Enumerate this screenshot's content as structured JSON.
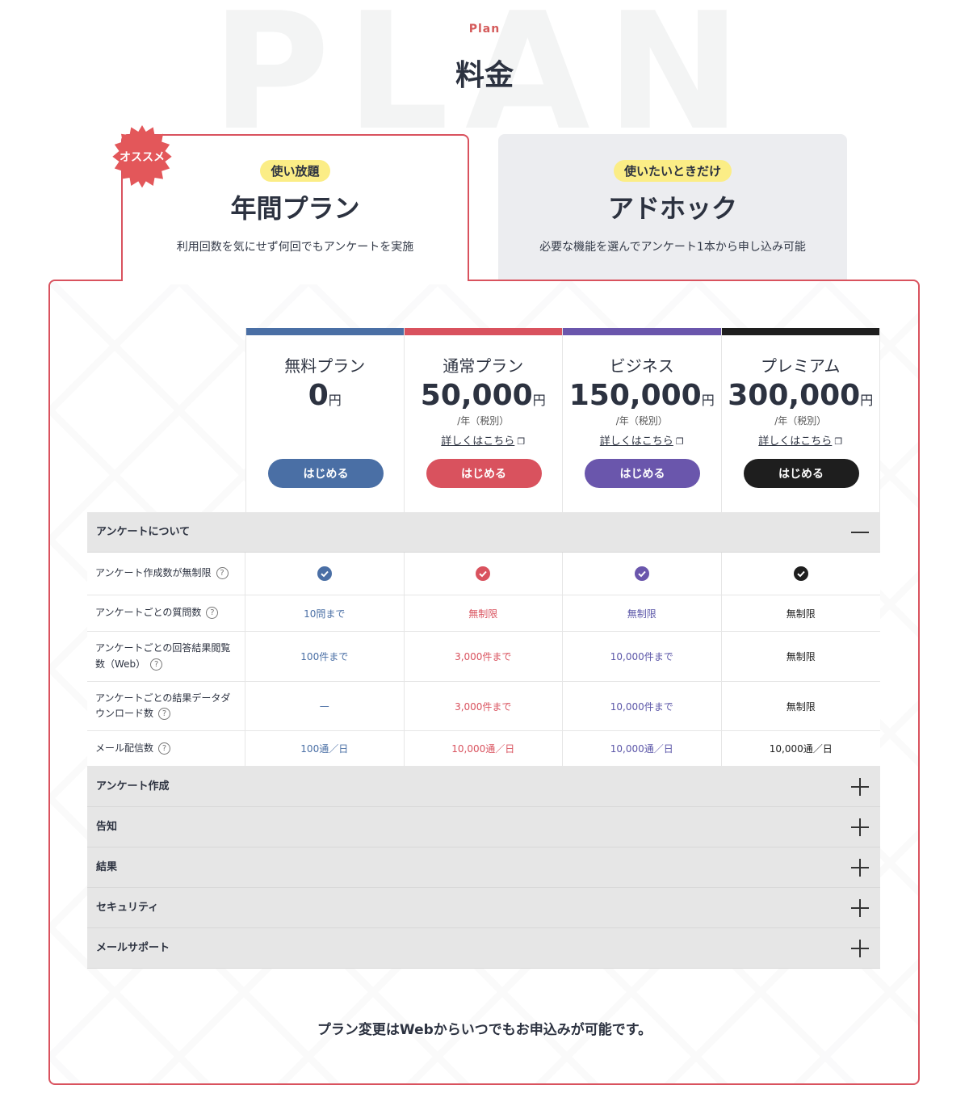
{
  "background_word": "PLAN",
  "header": {
    "eyebrow": "Plan",
    "title": "料金"
  },
  "recommend_badge": "オススメ",
  "tabs": [
    {
      "badge": "使い放題",
      "title": "年間プラン",
      "desc": "利用回数を気にせず何回でもアンケートを実施"
    },
    {
      "badge": "使いたいときだけ",
      "title": "アドホック",
      "desc": "必要な機能を選んでアンケート1本から申し込み可能"
    }
  ],
  "plans": [
    {
      "name": "無料プラン",
      "price": "0",
      "unit": "円",
      "period": "",
      "link": "",
      "button": "はじめる",
      "color": "#4a6fa5"
    },
    {
      "name": "通常プラン",
      "price": "50,000",
      "unit": "円",
      "period": "/年（税別）",
      "link": "詳しくはこちら",
      "button": "はじめる",
      "color": "#d9525e"
    },
    {
      "name": "ビジネス",
      "price": "150,000",
      "unit": "円",
      "period": "/年（税別）",
      "link": "詳しくはこちら",
      "button": "はじめる",
      "color": "#6a56ac"
    },
    {
      "name": "プレミアム",
      "price": "300,000",
      "unit": "円",
      "period": "/年（税別）",
      "link": "詳しくはこちら",
      "button": "はじめる",
      "color": "#1e1e1e"
    }
  ],
  "sections": {
    "survey": "アンケートについて",
    "create": "アンケート作成",
    "notice": "告知",
    "results": "結果",
    "security": "セキュリティ",
    "mail_support": "メールサポート"
  },
  "rows": [
    {
      "label": "アンケート作成数が無制限",
      "values": [
        "check",
        "check",
        "check",
        "check"
      ]
    },
    {
      "label": "アンケートごとの質問数",
      "values": [
        "10問まで",
        "無制限",
        "無制限",
        "無制限"
      ]
    },
    {
      "label": "アンケートごとの回答結果閲覧数（Web）",
      "values": [
        "100件まで",
        "3,000件まで",
        "10,000件まで",
        "無制限"
      ]
    },
    {
      "label": "アンケートごとの結果データダウンロード数",
      "values": [
        "—",
        "3,000件まで",
        "10,000件まで",
        "無制限"
      ]
    },
    {
      "label": "メール配信数",
      "values": [
        "100通／日",
        "10,000通／日",
        "10,000通／日",
        "10,000通／日"
      ]
    }
  ],
  "help_glyph": "?",
  "external_link_icon": "❐",
  "footnote": "プラン変更はWebからいつでもお申込みが可能です。"
}
